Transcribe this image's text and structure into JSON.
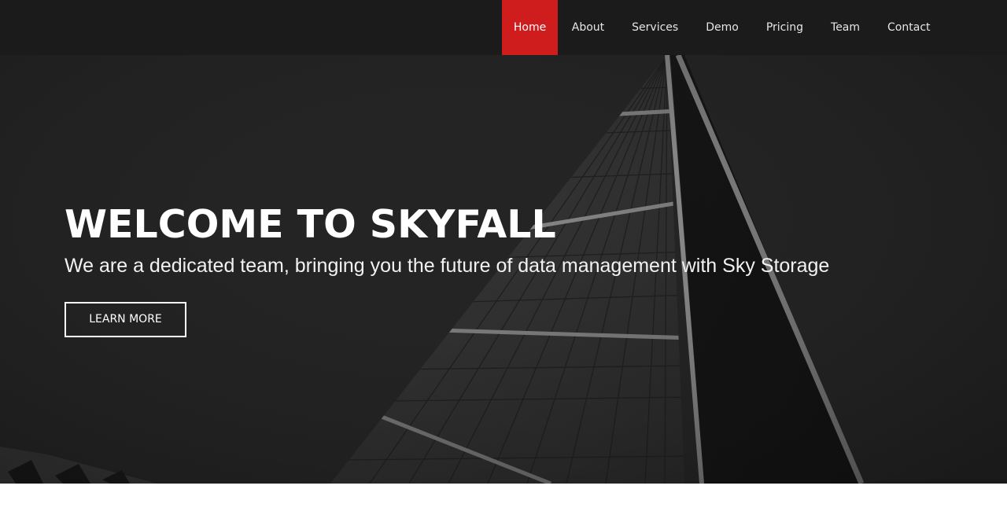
{
  "nav": {
    "items": [
      {
        "label": "Home",
        "active": true
      },
      {
        "label": "About"
      },
      {
        "label": "Services"
      },
      {
        "label": "Demo"
      },
      {
        "label": "Pricing"
      },
      {
        "label": "Team"
      },
      {
        "label": "Contact"
      }
    ]
  },
  "hero": {
    "title": "WELCOME TO SKYFALL",
    "subtitle": "We are a dedicated team, bringing you the future of data management with Sky Storage",
    "button_label": "LEARN MORE"
  },
  "colors": {
    "nav_background": "#1b1b1b",
    "nav_active": "#cf1d1d",
    "hero_overlay": "#262626",
    "text_primary": "#ffffff"
  }
}
